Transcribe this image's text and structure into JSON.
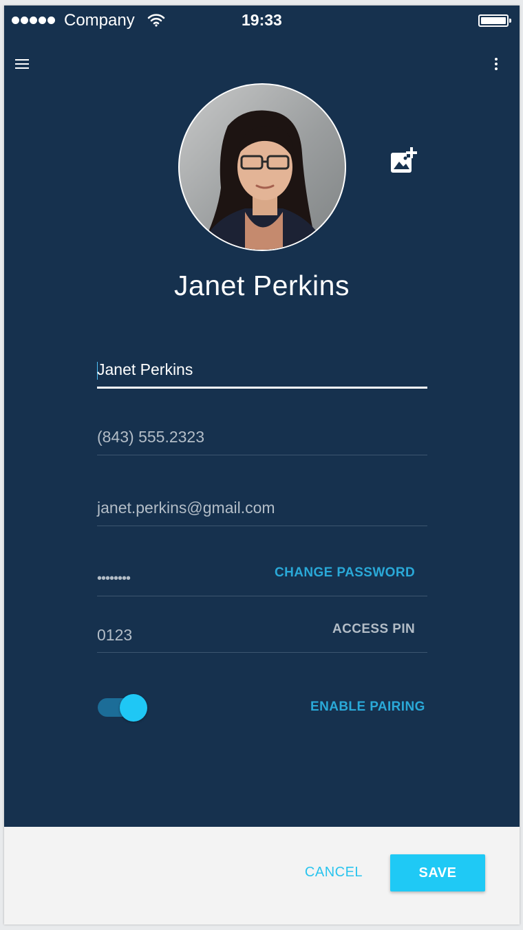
{
  "status_bar": {
    "carrier": "Company",
    "time": "19:33",
    "signal_bars": 5,
    "battery_level": 1.0
  },
  "app_bar": {
    "menu_icon": "hamburger-menu-icon",
    "more_icon": "more-vertical-icon"
  },
  "profile": {
    "avatar_icon": "profile-photo",
    "add_photo_icon": "add-photo-icon",
    "display_name": "Janet Perkins"
  },
  "form": {
    "name_value": "Janet Perkins",
    "phone_value": "(843) 555.2323",
    "email_value": "janet.perkins@gmail.com",
    "password_value": "••••••••",
    "change_password_label": "CHANGE PASSWORD",
    "pin_value": "0123",
    "access_pin_label": "ACCESS PIN",
    "pairing_enabled": true,
    "enable_pairing_label": "ENABLE PAIRING"
  },
  "footer": {
    "cancel_label": "CANCEL",
    "save_label": "SAVE"
  },
  "colors": {
    "background": "#16314e",
    "accent": "#1fc9f5",
    "link": "#2aa9d8",
    "muted_label": "#b3bdc7"
  }
}
